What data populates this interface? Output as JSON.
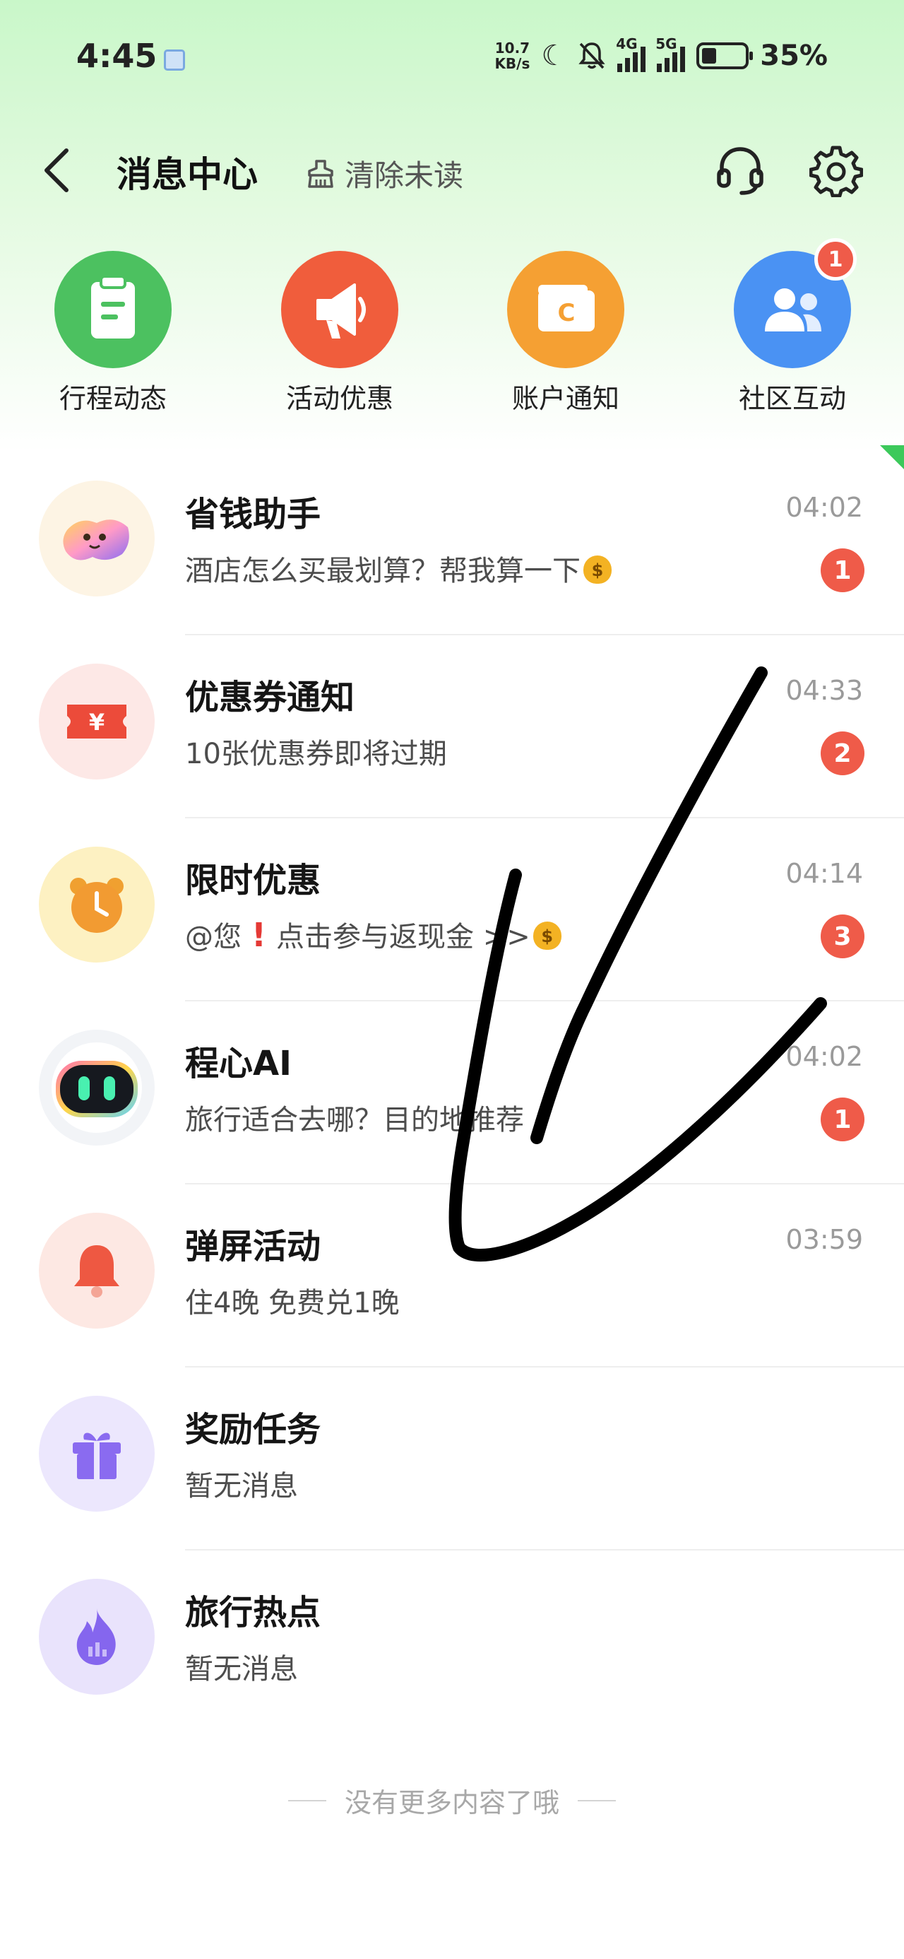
{
  "status_bar": {
    "time": "4:45",
    "net_speed_value": "10.7",
    "net_speed_unit": "KB/s",
    "signal1_label": "4G",
    "signal2_label": "5G",
    "battery_percent": "35%",
    "battery_level": 0.35
  },
  "header": {
    "title": "消息中心",
    "clear_label": "清除未读"
  },
  "categories": [
    {
      "label": "行程动态",
      "color": "#4cc160",
      "icon": "clipboard-icon",
      "badge": ""
    },
    {
      "label": "活动优惠",
      "color": "#f05d3c",
      "icon": "megaphone-icon",
      "badge": ""
    },
    {
      "label": "账户通知",
      "color": "#f5a033",
      "icon": "wallet-icon",
      "badge": ""
    },
    {
      "label": "社区互动",
      "color": "#4a92f3",
      "icon": "users-icon",
      "badge": "1"
    }
  ],
  "messages": [
    {
      "title": "省钱助手",
      "time": "04:02",
      "preview": "酒店怎么买最划算？帮我算一下",
      "badge": "1",
      "icon": "savings-mascot-icon"
    },
    {
      "title": "优惠券通知",
      "time": "04:33",
      "preview": "10张优惠券即将过期",
      "badge": "2",
      "icon": "coupon-icon"
    },
    {
      "title": "限时优惠",
      "time": "04:14",
      "preview_pre": "@您",
      "preview_post": "点击参与返现金 >>",
      "badge": "3",
      "icon": "alarm-clock-icon"
    },
    {
      "title": "程心AI",
      "time": "04:02",
      "preview": "旅行适合去哪？目的地推荐",
      "badge": "1",
      "icon": "robot-icon"
    },
    {
      "title": "弹屏活动",
      "time": "03:59",
      "preview": "住4晚 免费兑1晚",
      "badge": "",
      "icon": "bell-icon"
    },
    {
      "title": "奖励任务",
      "time": "",
      "preview": "暂无消息",
      "badge": "",
      "icon": "gift-icon"
    },
    {
      "title": "旅行热点",
      "time": "",
      "preview": "暂无消息",
      "badge": "",
      "icon": "flame-icon"
    }
  ],
  "footer": {
    "text": "没有更多内容了哦"
  },
  "colors": {
    "accent_green": "#3cc95b",
    "badge_red": "#ef5b49"
  }
}
